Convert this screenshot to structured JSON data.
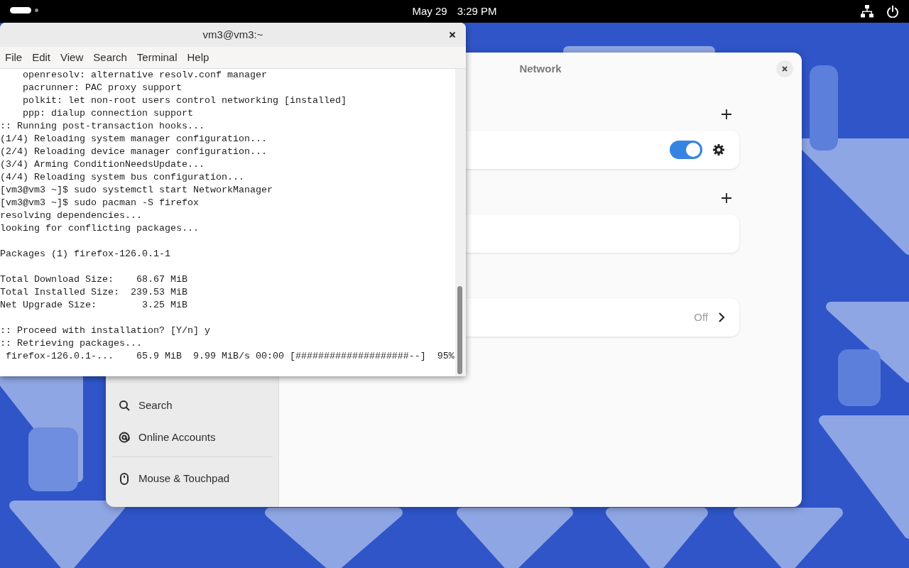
{
  "top_bar": {
    "date": "May 29",
    "time": "3:29 PM"
  },
  "terminal": {
    "title": "vm3@vm3:~",
    "menu": [
      "File",
      "Edit",
      "View",
      "Search",
      "Terminal",
      "Help"
    ],
    "blocks": [
      [
        "    openresolv: alternative resolv.conf manager",
        "    pacrunner: PAC proxy support",
        "    polkit: let non-root users control networking [installed]",
        "    ppp: dialup connection support",
        ":: Running post-transaction hooks...",
        "(1/4) Reloading system manager configuration...",
        "(2/4) Reloading device manager configuration...",
        "(3/4) Arming ConditionNeedsUpdate...",
        "(4/4) Reloading system bus configuration...",
        "[vm3@vm3 ~]$ sudo systemctl start NetworkManager",
        "[vm3@vm3 ~]$ sudo pacman -S firefox",
        "resolving dependencies...",
        "looking for conflicting packages..."
      ],
      [
        "Packages (1) firefox-126.0.1-1"
      ],
      [
        "Total Download Size:    68.67 MiB",
        "Total Installed Size:  239.53 MiB",
        "Net Upgrade Size:        3.25 MiB"
      ],
      [
        ":: Proceed with installation? [Y/n] y",
        ":: Retrieving packages...",
        " firefox-126.0.1-...    65.9 MiB  9.99 MiB/s 00:00 [####################--]  95%"
      ]
    ]
  },
  "settings": {
    "title": "Network",
    "sidebar": [
      {
        "kind": "search",
        "label": "Search",
        "divider_before": false
      },
      {
        "kind": "at",
        "label": "Online Accounts",
        "divider_before": false
      },
      {
        "kind": "mouse",
        "label": "Mouse & Touchpad",
        "divider_before": true
      }
    ],
    "sections": [
      {
        "kind": "switch",
        "add": true,
        "on": true
      },
      {
        "kind": "empty",
        "add": true
      },
      {
        "kind": "status",
        "add": false,
        "value": "Off"
      }
    ]
  }
}
